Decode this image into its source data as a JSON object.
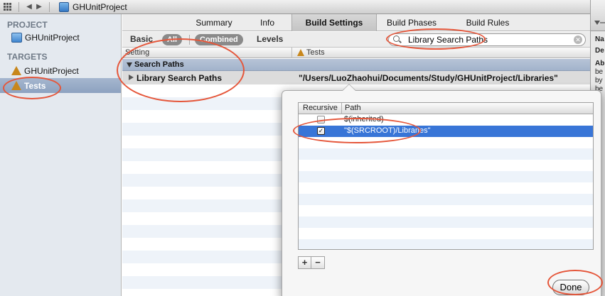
{
  "jumpbar": {
    "project": "GHUnitProject"
  },
  "navigator": {
    "project_header": "PROJECT",
    "project_item": "GHUnitProject",
    "targets_header": "TARGETS",
    "targets": [
      "GHUnitProject",
      "Tests"
    ],
    "selected_target": "Tests"
  },
  "tabs": [
    "Summary",
    "Info",
    "Build Settings",
    "Build Phases",
    "Build Rules"
  ],
  "active_tab": "Build Settings",
  "filter": {
    "basic": "Basic",
    "all": "All",
    "combined": "Combined",
    "levels": "Levels",
    "search_value": "Library Search Paths"
  },
  "settings": {
    "header_setting": "Setting",
    "header_target": "Tests",
    "group": "Search Paths",
    "row_name": "Library Search Paths",
    "row_value": "\"/Users/LuoZhaohui/Documents/Study/GHUnitProject/Libraries\""
  },
  "popover": {
    "header_recursive": "Recursive",
    "header_path": "Path",
    "rows": [
      {
        "path": "$(inherited)",
        "checked": false
      },
      {
        "path": "\"$(SRCROOT)/Libraries\"",
        "checked": true
      }
    ],
    "plus": "+",
    "minus": "−",
    "done": "Done"
  },
  "inspector": [
    "Na",
    "De",
    "Ab",
    "be",
    "by",
    "be"
  ],
  "colors": {
    "annotation": "#e5563a",
    "selection": "#3875d7",
    "group_row": "#a2b3cb"
  }
}
